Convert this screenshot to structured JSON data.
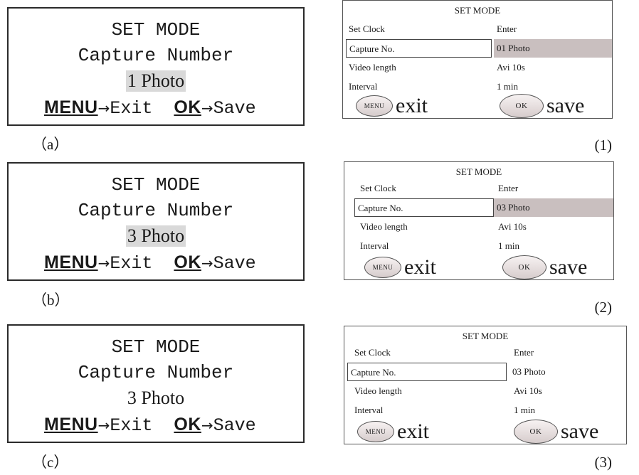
{
  "panels_left": [
    {
      "title": "SET MODE",
      "subtitle": "Capture Number",
      "value": "1 Photo",
      "highlighted": true,
      "menu_key": "MENU",
      "exit_label": "Exit",
      "ok_key": "OK",
      "save_label": "Save",
      "caption": "（a）"
    },
    {
      "title": "SET MODE",
      "subtitle": "Capture Number",
      "value": "3 Photo",
      "highlighted": true,
      "menu_key": "MENU",
      "exit_label": "Exit",
      "ok_key": "OK",
      "save_label": "Save",
      "caption": "（b）"
    },
    {
      "title": "SET MODE",
      "subtitle": "Capture Number",
      "value": "3 Photo",
      "highlighted": false,
      "menu_key": "MENU",
      "exit_label": "Exit",
      "ok_key": "OK",
      "save_label": "Save",
      "caption": "（c）"
    }
  ],
  "panels_right": [
    {
      "header": "SET MODE",
      "caption": "(1)",
      "value_highlighted": true,
      "rows": [
        {
          "label": "Set Clock",
          "value": "Enter"
        },
        {
          "label": "Capture No.",
          "value": "01 Photo"
        },
        {
          "label": "Video length",
          "value": "Avi 10s"
        },
        {
          "label": "Interval",
          "value": "1 min"
        }
      ],
      "menu_btn": "MENU",
      "exit_label": "exit",
      "ok_btn": "OK",
      "save_label": "save"
    },
    {
      "header": "SET MODE",
      "caption": "(2)",
      "value_highlighted": true,
      "rows": [
        {
          "label": "Set Clock",
          "value": "Enter"
        },
        {
          "label": "Capture No.",
          "value": "03 Photo"
        },
        {
          "label": "Video length",
          "value": "Avi 10s"
        },
        {
          "label": "Interval",
          "value": "1 min"
        }
      ],
      "menu_btn": "MENU",
      "exit_label": "exit",
      "ok_btn": "OK",
      "save_label": "save"
    },
    {
      "header": "SET MODE",
      "caption": "(3)",
      "value_highlighted": false,
      "rows": [
        {
          "label": "Set Clock",
          "value": "Enter"
        },
        {
          "label": "Capture No.",
          "value": "03 Photo"
        },
        {
          "label": "Video length",
          "value": "Avi 10s"
        },
        {
          "label": "Interval",
          "value": "1 min"
        }
      ],
      "menu_btn": "MENU",
      "exit_label": "exit",
      "ok_btn": "OK",
      "save_label": "save"
    }
  ],
  "colors": {
    "value_highlight": "#d9d9d9",
    "menu_highlight": "#c9bfbf",
    "border": "#2a2a2a"
  }
}
